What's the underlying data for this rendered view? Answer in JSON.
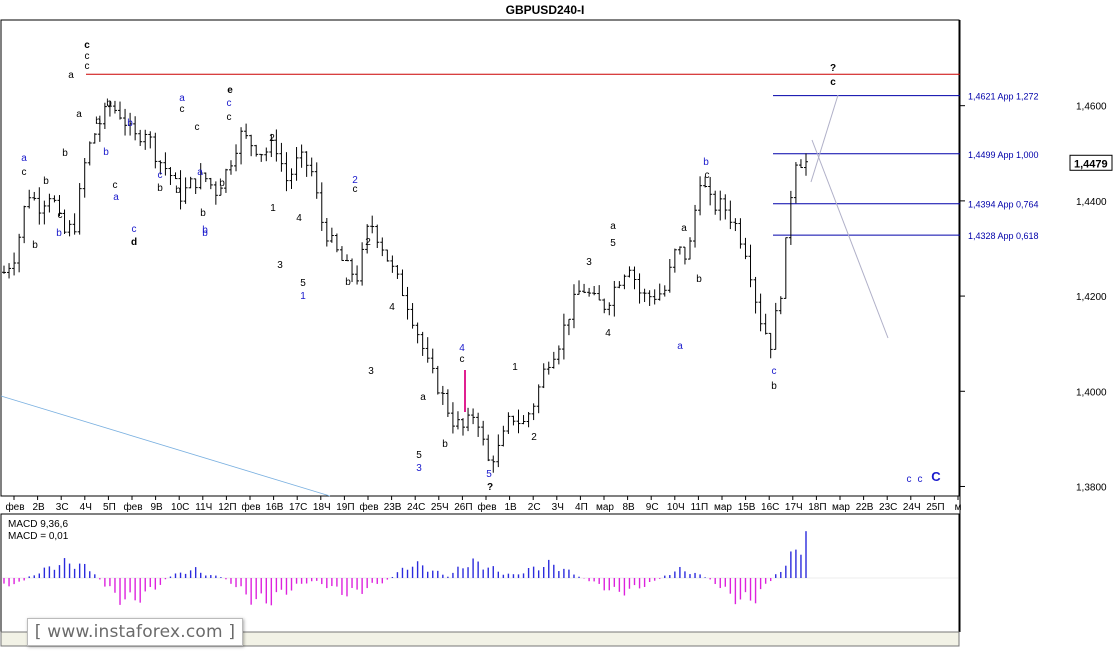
{
  "chart_data": {
    "type": "ohlc",
    "title": "GBPUSD240-I",
    "current_price": "1,4479",
    "y_ticks": [
      "1,4600",
      "1,4400",
      "1,4200",
      "1,4000",
      "1,3800"
    ],
    "ylim": [
      1.378,
      1.478
    ],
    "x_ticks": [
      "фев",
      "2В",
      "3С",
      "4Ч",
      "5П",
      "фев",
      "9В",
      "10С",
      "11Ч",
      "12П",
      "фев",
      "16В",
      "17С",
      "18Ч",
      "19П",
      "фев",
      "23В",
      "24С",
      "25Ч",
      "26П",
      "фев",
      "1В",
      "2С",
      "3Ч",
      "4П",
      "мар",
      "8В",
      "9С",
      "10Ч",
      "11П",
      "мар",
      "15В",
      "16С",
      "17Ч",
      "18П",
      "мар",
      "22В",
      "23С",
      "24Ч",
      "25П",
      "м"
    ],
    "resistance": {
      "label": "",
      "value": 1.4666,
      "color": "#cc0000"
    },
    "fib_levels": [
      {
        "label": "1,4621 App 1,272",
        "value": 1.4621
      },
      {
        "label": "1,4499 App 1,000",
        "value": 1.4499
      },
      {
        "label": "1,4394 App 0,764",
        "value": 1.4394
      },
      {
        "label": "1,4328 App 0,618",
        "value": 1.4328
      }
    ],
    "close_path": [
      1.425,
      1.429,
      1.442,
      1.439,
      1.442,
      1.433,
      1.435,
      1.45,
      1.456,
      1.46,
      1.458,
      1.453,
      1.455,
      1.449,
      1.446,
      1.441,
      1.444,
      1.445,
      1.442,
      1.447,
      1.454,
      1.452,
      1.45,
      1.452,
      1.444,
      1.449,
      1.447,
      1.435,
      1.43,
      1.426,
      1.424,
      1.436,
      1.431,
      1.425,
      1.42,
      1.413,
      1.405,
      1.4,
      1.394,
      1.392,
      1.396,
      1.385,
      1.388,
      1.395,
      1.393,
      1.398,
      1.406,
      1.41,
      1.417,
      1.422,
      1.419,
      1.418,
      1.423,
      1.427,
      1.42,
      1.42,
      1.421,
      1.43,
      1.428,
      1.445,
      1.439,
      1.439,
      1.435,
      1.429,
      1.416,
      1.41,
      1.423,
      1.449,
      1.448
    ],
    "indicator": {
      "name": "MACD 9,36,6",
      "value_label": "MACD = 0,01",
      "values": [
        -0.2,
        -0.25,
        0.05,
        0.25,
        0.45,
        0.55,
        0.45,
        0.25,
        -0.3,
        -0.7,
        -0.8,
        -0.6,
        -0.3,
        0.05,
        0.2,
        0.3,
        0.1,
        0.05,
        -0.2,
        -0.6,
        -0.85,
        -0.75,
        -0.5,
        -0.3,
        -0.1,
        -0.2,
        -0.4,
        -0.55,
        -0.45,
        -0.25,
        -0.1,
        0.2,
        0.5,
        0.4,
        0.2,
        0.05,
        0.45,
        0.55,
        0.4,
        0.2,
        0.1,
        0.25,
        0.4,
        0.5,
        0.3,
        0.1,
        -0.1,
        -0.3,
        -0.5,
        -0.45,
        -0.3,
        -0.15,
        0.1,
        0.3,
        0.2,
        0.05,
        -0.2,
        -0.6,
        -0.8,
        -0.7,
        -0.2,
        0.3,
        0.8,
        1.6
      ]
    },
    "wave_labels": [
      {
        "t": "c",
        "c": "#000"
      },
      {
        "t": "c",
        "c": "#000"
      },
      {
        "t": "c",
        "c": "#000"
      },
      {
        "t": "a",
        "c": "#000"
      },
      {
        "t": "b",
        "c": "#000"
      },
      {
        "t": "a",
        "c": "#1a1acc"
      },
      {
        "t": "c",
        "c": "#000"
      },
      {
        "t": "b",
        "c": "#000"
      },
      {
        "t": "a",
        "c": "#000"
      },
      {
        "t": "b",
        "c": "#000"
      },
      {
        "t": "c",
        "c": "#000"
      },
      {
        "t": "b",
        "c": "#1a1acc"
      },
      {
        "t": "b",
        "c": "#1a1acc"
      },
      {
        "t": "b",
        "c": "#000"
      },
      {
        "t": "b",
        "c": "#000"
      },
      {
        "t": "c",
        "c": "#000"
      },
      {
        "t": "a",
        "c": "#1a1acc"
      },
      {
        "t": "b",
        "c": "#1a1acc"
      },
      {
        "t": "c",
        "c": "#1a1acc"
      },
      {
        "t": "d",
        "c": "#000"
      },
      {
        "t": "a",
        "c": "#1a1acc"
      },
      {
        "t": "c",
        "c": "#000"
      },
      {
        "t": "b",
        "c": "#000"
      },
      {
        "t": "a",
        "c": "#1a1acc"
      },
      {
        "t": "b",
        "c": "#000"
      },
      {
        "t": "c",
        "c": "#1a1acc"
      },
      {
        "t": "b",
        "c": "#000"
      },
      {
        "t": "b",
        "c": "#1a1acc"
      },
      {
        "t": "e",
        "c": "#000"
      },
      {
        "t": "c",
        "c": "#1a1acc"
      },
      {
        "t": "c",
        "c": "#000"
      },
      {
        "t": "b",
        "c": "#000"
      },
      {
        "t": "c",
        "c": "#000"
      },
      {
        "t": "b",
        "c": "#1a1acc"
      },
      {
        "t": "2",
        "c": "#000"
      },
      {
        "t": "1",
        "c": "#000"
      },
      {
        "t": "3",
        "c": "#000"
      },
      {
        "t": "4",
        "c": "#000"
      },
      {
        "t": "5",
        "c": "#000"
      },
      {
        "t": "1",
        "c": "#1a1acc"
      },
      {
        "t": "2",
        "c": "#1a1acc"
      },
      {
        "t": "c",
        "c": "#000"
      },
      {
        "t": "2",
        "c": "#000"
      },
      {
        "t": "b",
        "c": "#000"
      },
      {
        "t": "4",
        "c": "#000"
      },
      {
        "t": "3",
        "c": "#000"
      },
      {
        "t": "a",
        "c": "#000"
      },
      {
        "t": "b",
        "c": "#000"
      },
      {
        "t": "5",
        "c": "#000"
      },
      {
        "t": "3",
        "c": "#1a1acc"
      },
      {
        "t": "4",
        "c": "#1a1acc"
      },
      {
        "t": "c",
        "c": "#000"
      },
      {
        "t": "5",
        "c": "#1a1acc"
      },
      {
        "t": "?",
        "c": "#000"
      },
      {
        "t": "1",
        "c": "#000"
      },
      {
        "t": "2",
        "c": "#000"
      },
      {
        "t": "a",
        "c": "#000"
      },
      {
        "t": "5",
        "c": "#000"
      },
      {
        "t": "3",
        "c": "#000"
      },
      {
        "t": "4",
        "c": "#000"
      },
      {
        "t": "a",
        "c": "#000"
      },
      {
        "t": "a",
        "c": "#1a1acc"
      },
      {
        "t": "b",
        "c": "#000"
      },
      {
        "t": "b",
        "c": "#1a1acc"
      },
      {
        "t": "c",
        "c": "#000"
      },
      {
        "t": "c",
        "c": "#1a1acc"
      },
      {
        "t": "b",
        "c": "#000"
      },
      {
        "t": "?",
        "c": "#000"
      },
      {
        "t": "c",
        "c": "#000"
      },
      {
        "t": "c",
        "c": "#1a1acc"
      },
      {
        "t": "c",
        "c": "#1a1acc"
      },
      {
        "t": "C",
        "c": "#1a1acc"
      }
    ]
  },
  "watermark": "[ www.instaforex.com ]",
  "colors": {
    "bars": "#000000",
    "fib": "#0000aa",
    "macd_pos": "#2b2bdd",
    "macd_neg": "#dd22dd",
    "projection": "#b0b0c8",
    "trend": "#7ab0e0"
  }
}
